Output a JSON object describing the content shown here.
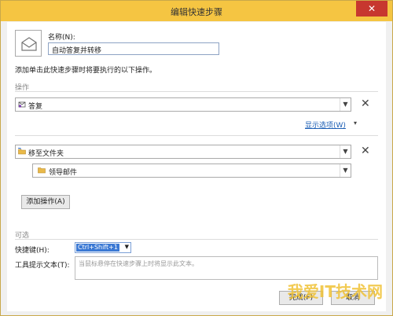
{
  "window": {
    "title": "编辑快速步骤",
    "close": "✕"
  },
  "name": {
    "label": "名称(N):",
    "value": "自动答复并转移"
  },
  "instruction": "添加单击此快速步骤时将要执行的以下操作。",
  "actions_section": {
    "label": "操作",
    "action1": {
      "value": "答复",
      "remove": "✕"
    },
    "show_options": "显示选项(W)",
    "action2": {
      "value": "移至文件夹",
      "remove": "✕",
      "folder": "领导邮件"
    },
    "add_button": "添加操作(A)"
  },
  "optional_section": {
    "label": "可选",
    "shortcut_label": "快捷键(H):",
    "shortcut_value": "Ctrl+Shift+1",
    "tooltip_label": "工具提示文本(T):",
    "tooltip_placeholder": "当鼠标悬停在快速步骤上时将显示此文本。"
  },
  "buttons": {
    "finish": "完成(F)",
    "cancel": "取消"
  },
  "watermark": "我爱IT技术网",
  "colors": {
    "accent": "#f5c542",
    "link": "#1d5fb5",
    "selection": "#3b79d4"
  }
}
